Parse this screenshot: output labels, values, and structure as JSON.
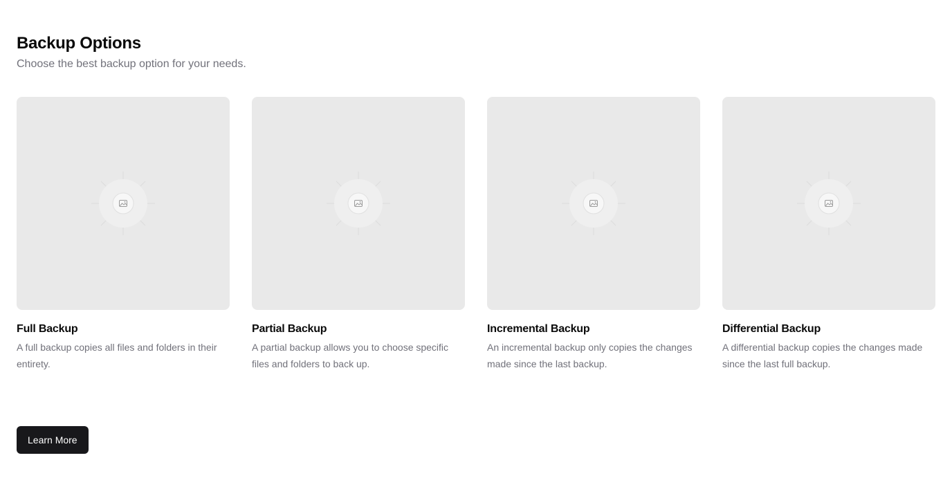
{
  "header": {
    "title": "Backup Options",
    "subtitle": "Choose the best backup option for your needs."
  },
  "cards": [
    {
      "title": "Full Backup",
      "description": "A full backup copies all files and folders in their entirety.",
      "image_icon": "image-placeholder-icon"
    },
    {
      "title": "Partial Backup",
      "description": "A partial backup allows you to choose specific files and folders to back up.",
      "image_icon": "image-placeholder-icon"
    },
    {
      "title": "Incremental Backup",
      "description": "An incremental backup only copies the changes made since the last backup.",
      "image_icon": "image-placeholder-icon"
    },
    {
      "title": "Differential Backup",
      "description": "A differential backup copies the changes made since the last full backup.",
      "image_icon": "image-placeholder-icon"
    }
  ],
  "actions": {
    "learn_more_label": "Learn More"
  },
  "colors": {
    "background": "#ffffff",
    "card_placeholder": "#e9e9e9",
    "text_muted": "#71717a",
    "button_bg": "#18181b",
    "button_text": "#ffffff"
  }
}
